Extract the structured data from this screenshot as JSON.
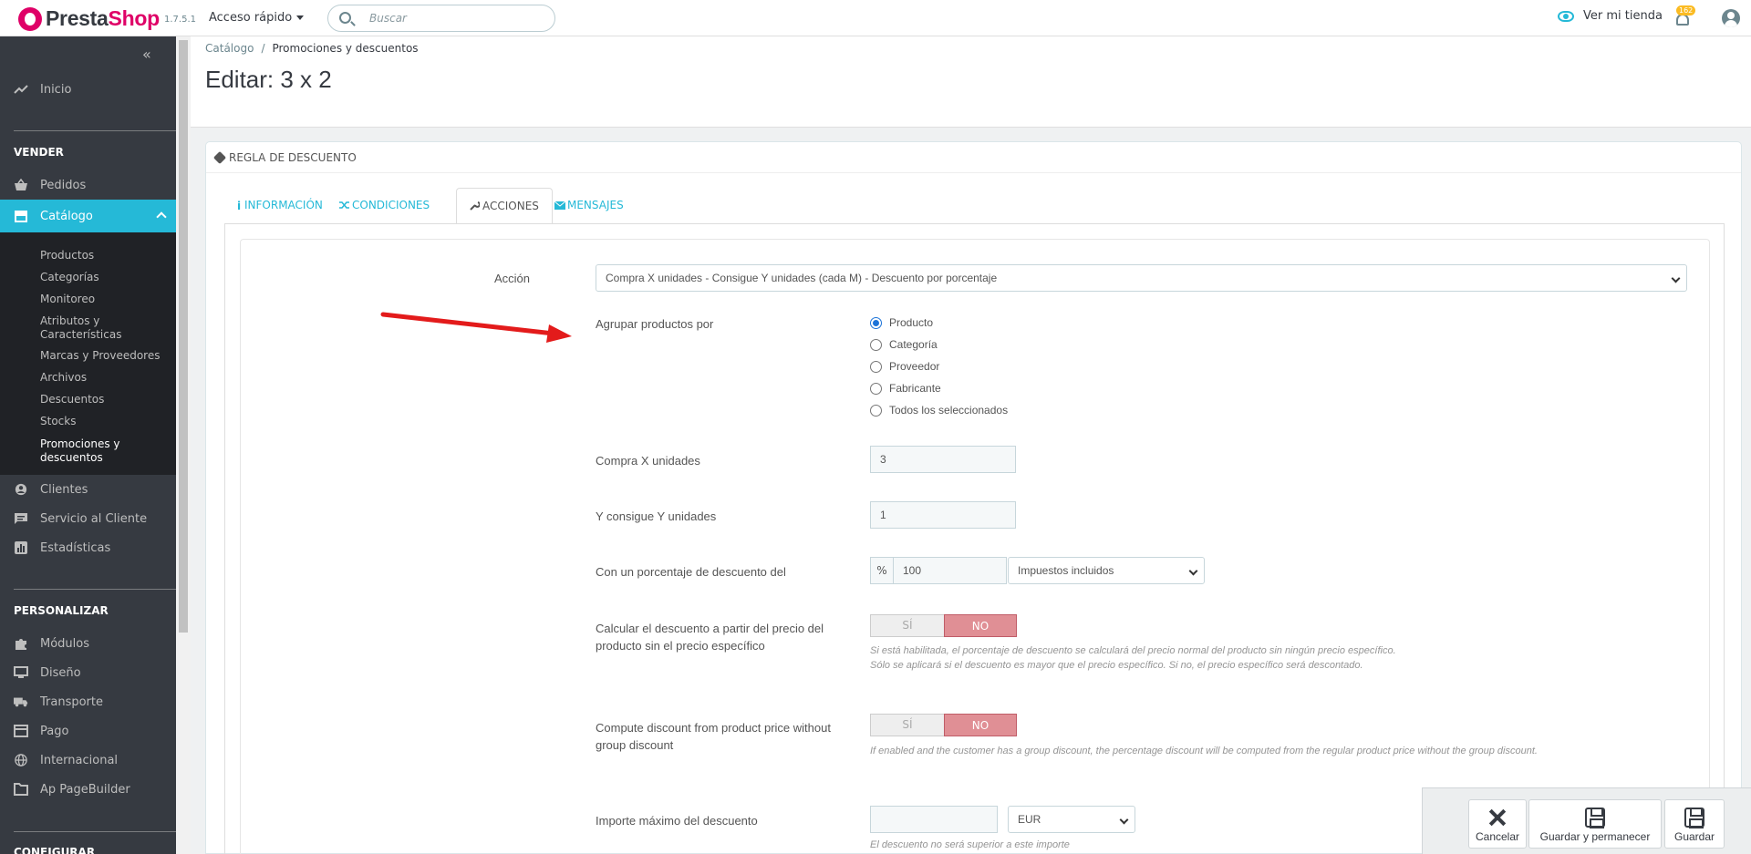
{
  "header": {
    "logo_part1": "Presta",
    "logo_part2": "Shop",
    "version": "1.7.5.1",
    "quick_access": "Acceso rápido",
    "search_placeholder": "Buscar",
    "view_shop": "Ver mi tienda",
    "notifications_count": "162"
  },
  "sidebar": {
    "home": "Inicio",
    "section_sell": "VENDER",
    "orders": "Pedidos",
    "catalog": "Catálogo",
    "catalog_sub": [
      "Productos",
      "Categorías",
      "Monitoreo",
      "Atributos y Características",
      "Marcas y Proveedores",
      "Archivos",
      "Descuentos",
      "Stocks",
      "Promociones y descuentos"
    ],
    "customers": "Clientes",
    "customer_service": "Servicio al Cliente",
    "stats": "Estadísticas",
    "section_customize": "PERSONALIZAR",
    "modules": "Módulos",
    "design": "Diseño",
    "shipping": "Transporte",
    "payment": "Pago",
    "international": "Internacional",
    "pagebuilder": "Ap PageBuilder",
    "section_configure": "CONFIGURAR"
  },
  "page": {
    "breadcrumb_1": "Catálogo",
    "breadcrumb_sep": "/",
    "breadcrumb_2": "Promociones y descuentos",
    "title": "Editar: 3 x 2"
  },
  "panel": {
    "heading": "REGLA DE DESCUENTO",
    "tabs": [
      "INFORMACIÓN",
      "CONDICIONES",
      "ACCIONES",
      "MENSAJES"
    ]
  },
  "form": {
    "action_label": "Acción",
    "action_value": "Compra X unidades - Consigue Y unidades (cada M) - Descuento por porcentaje",
    "group_label": "Agrupar productos por",
    "group_options": [
      "Producto",
      "Categoría",
      "Proveedor",
      "Fabricante",
      "Todos los seleccionados"
    ],
    "group_selected": "Producto",
    "buy_x_label": "Compra X unidades",
    "buy_x_value": "3",
    "get_y_label": "Y consigue Y unidades",
    "get_y_value": "1",
    "percent_label": "Con un porcentaje de descuento del",
    "percent_symbol": "%",
    "percent_value": "100",
    "tax_value": "Impuestos incluidos",
    "calc_label_1": "Calcular el descuento a partir del precio del",
    "calc_label_2": "producto sin el precio específico",
    "toggle_yes": "SÍ",
    "toggle_no": "NO",
    "calc_help_1": "Si está habilitada, el porcentaje de descuento se calculará del precio normal del producto sin ningún precio específico.",
    "calc_help_2": "Sólo se aplicará si el descuento es mayor que el precio específico. Si no, el precio específico será descontado.",
    "group_disc_label_1": "Compute discount from product price without",
    "group_disc_label_2": "group discount",
    "group_disc_help": "If enabled and the customer has a group discount, the percentage discount will be computed from the regular product price without the group discount.",
    "max_label": "Importe máximo del descuento",
    "max_value": "",
    "currency_value": "EUR",
    "max_help": "El descuento no será superior a este importe"
  },
  "footer": {
    "cancel": "Cancelar",
    "save_stay": "Guardar y permanecer",
    "save": "Guardar"
  },
  "colors": {
    "accent": "#25b9d7",
    "brand": "#df0067",
    "sidebar_bg": "#363a41",
    "toggle_no": "#e08f95",
    "arrow": "#e31b1b"
  }
}
